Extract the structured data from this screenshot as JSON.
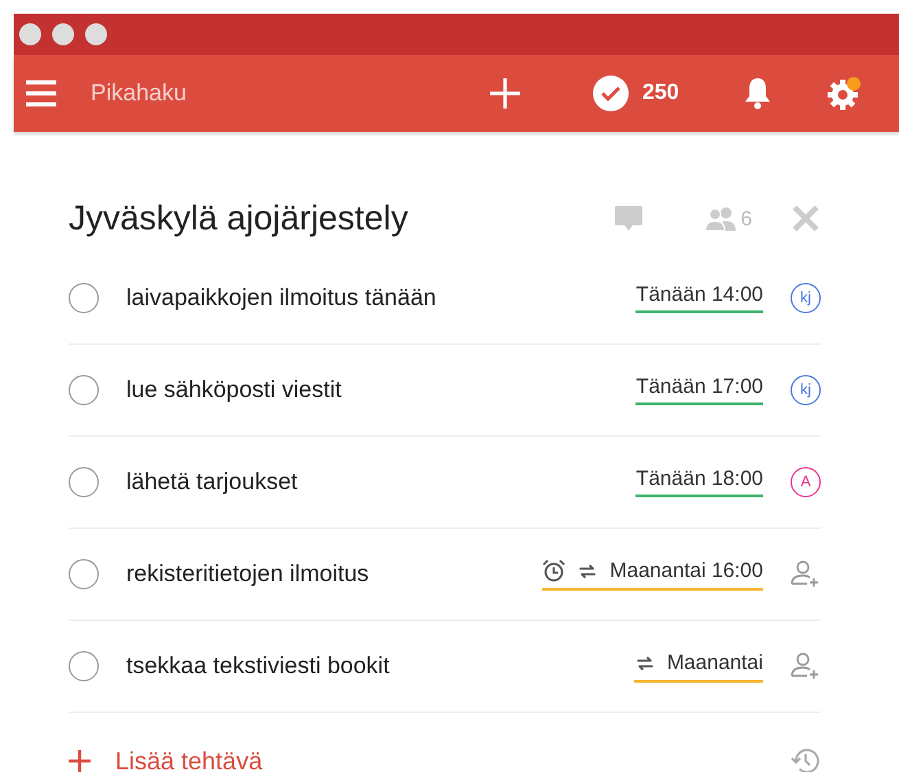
{
  "toolbar": {
    "search_placeholder": "Pikahaku",
    "karma": "250",
    "settings_notification": true
  },
  "project": {
    "title": "Jyväskylä ajojärjestely",
    "members": "6"
  },
  "tasks": [
    {
      "name": "laivapaikkojen ilmoitus tänään",
      "checked": false,
      "due": "Tänään 14:00",
      "color": "#3db36b",
      "reminder": false,
      "repeat": false,
      "assignee": {
        "kind": "avatar",
        "initials": "kj",
        "color": "#4a78e0"
      }
    },
    {
      "name": "lue sähköposti viestit",
      "checked": false,
      "due": "Tänään 17:00",
      "color": "#3db36b",
      "reminder": false,
      "repeat": false,
      "assignee": {
        "kind": "avatar",
        "initials": "kj",
        "color": "#4a78e0"
      }
    },
    {
      "name": "lähetä tarjoukset",
      "checked": false,
      "due": "Tänään 18:00",
      "color": "#3db36b",
      "reminder": false,
      "repeat": false,
      "assignee": {
        "kind": "avatar",
        "initials": "A",
        "color": "#e8348f"
      }
    },
    {
      "name": "rekisteritietojen ilmoitus",
      "checked": false,
      "due": "Maanantai 16:00",
      "color": "#f7b733",
      "reminder": true,
      "repeat": true,
      "assignee": {
        "kind": "unassigned"
      }
    },
    {
      "name": "tsekkaa tekstiviesti bookit",
      "checked": false,
      "due": "Maanantai",
      "color": "#f7b733",
      "reminder": false,
      "repeat": true,
      "assignee": {
        "kind": "unassigned"
      }
    }
  ],
  "add_task": "Lisää tehtävä"
}
